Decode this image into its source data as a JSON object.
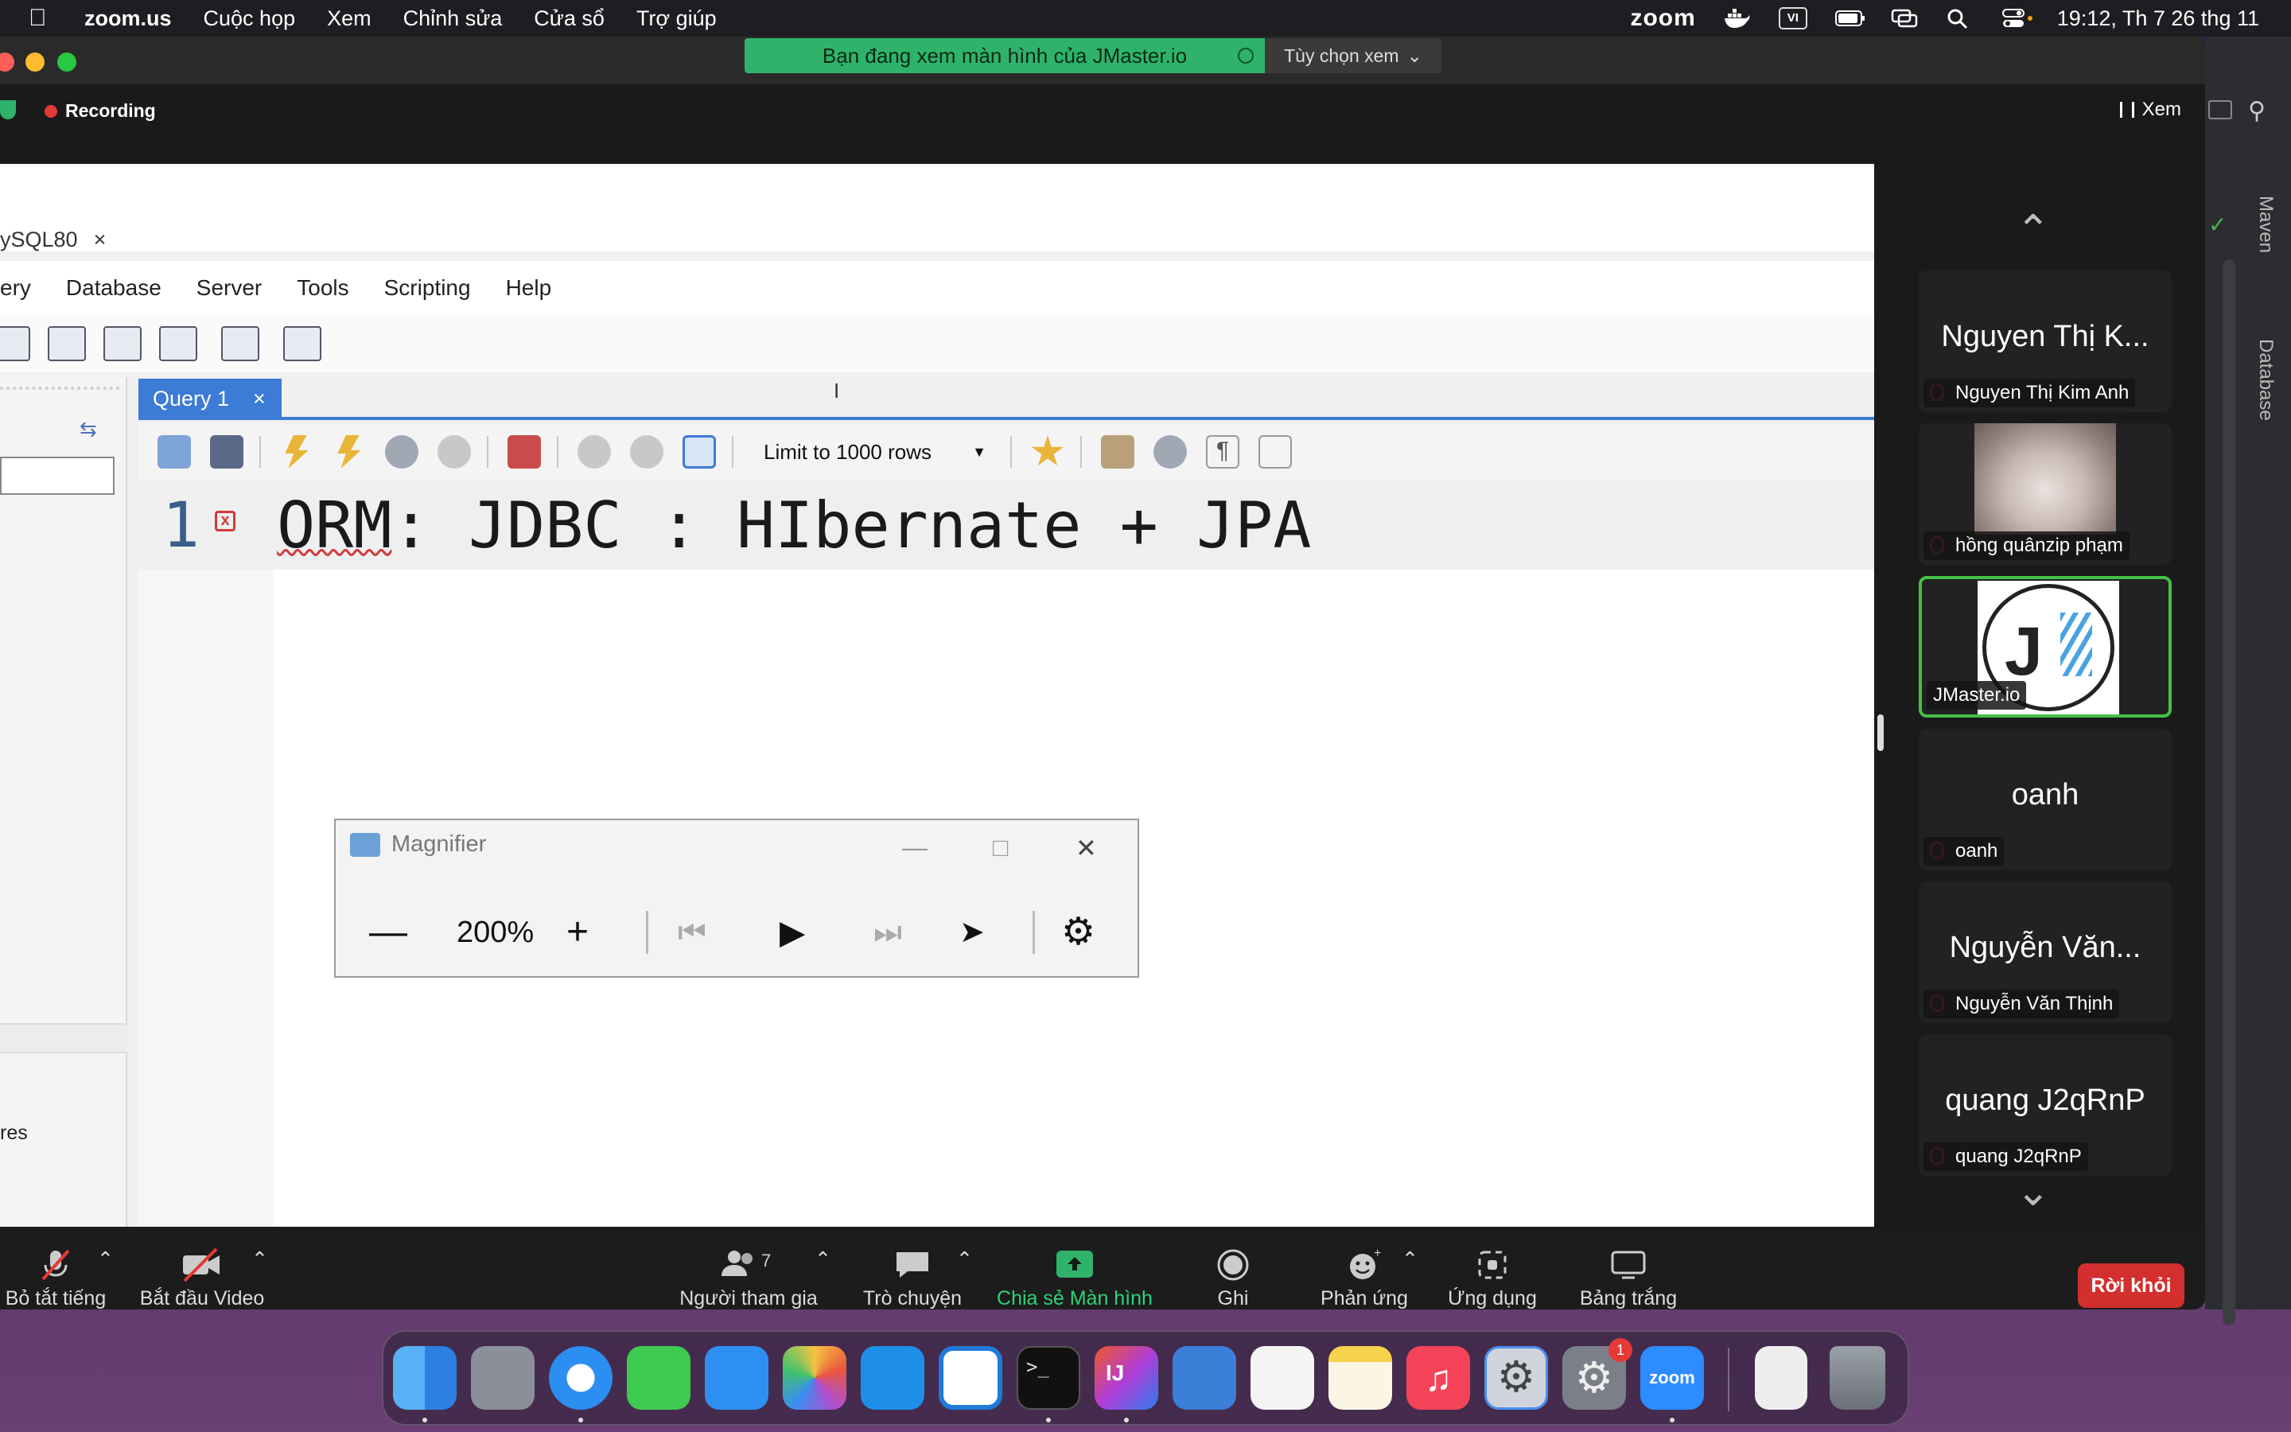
{
  "menubar": {
    "app": "zoom.us",
    "items": [
      "Cuộc họp",
      "Xem",
      "Chỉnh sửa",
      "Cửa sổ",
      "Trợ giúp"
    ],
    "zoom_brand": "zoom",
    "input_source": "VI",
    "clock": "19:12, Th 7 26 thg 11"
  },
  "zoom": {
    "share_banner": "Bạn đang xem màn hình của JMaster.io",
    "view_options": "Tùy chọn xem",
    "recording": "Recording",
    "view_label": "Xem"
  },
  "workbench": {
    "connection_tab": "ySQL80",
    "close_glyph": "×",
    "menu": [
      "ery",
      "Database",
      "Server",
      "Tools",
      "Scripting",
      "Help"
    ],
    "query_tab": "Query 1",
    "limit_select": "Limit to 1000 rows",
    "line_number": "1",
    "code_squiggled": "ORM",
    "code_rest": ": JDBC : HIbernate + JPA",
    "sidebar_fragment": "res"
  },
  "magnifier": {
    "title": "Magnifier",
    "zoom_level": "200%",
    "minus": "—",
    "plus": "+"
  },
  "participants": [
    {
      "display": "Nguyen Thị K...",
      "name": "Nguyen Thị Kim Anh",
      "muted": true,
      "type": "text"
    },
    {
      "display": "",
      "name": "hồng quânzip phạm",
      "muted": true,
      "type": "photo"
    },
    {
      "display": "",
      "name": "JMaster.io",
      "muted": false,
      "type": "logo",
      "active": true
    },
    {
      "display": "oanh",
      "name": "oanh",
      "muted": true,
      "type": "text"
    },
    {
      "display": "Nguyễn Văn...",
      "name": "Nguyễn Văn Thịnh",
      "muted": true,
      "type": "text"
    },
    {
      "display": "quang J2qRnP",
      "name": "quang J2qRnP",
      "muted": true,
      "type": "text"
    }
  ],
  "ide_side": {
    "maven": "Maven",
    "database": "Database"
  },
  "controls": {
    "mute": "Bỏ tắt tiếng",
    "video": "Bắt đầu Video",
    "participants": "Người tham gia",
    "participants_count": "7",
    "chat": "Trò chuyện",
    "share": "Chia sẻ Màn hình",
    "record": "Ghi",
    "reactions": "Phản ứng",
    "apps": "Ứng dụng",
    "whiteboard": "Bảng trắng",
    "leave": "Rời khỏi"
  },
  "dock": {
    "badge_count": "1",
    "zoom_label": "zoom",
    "intellij_label": "IJ"
  },
  "colors": {
    "zoom_green": "#2fb36b",
    "leave_red": "#d32f2f",
    "query_tab_blue": "#3c7bd6",
    "active_border": "#46c046"
  }
}
